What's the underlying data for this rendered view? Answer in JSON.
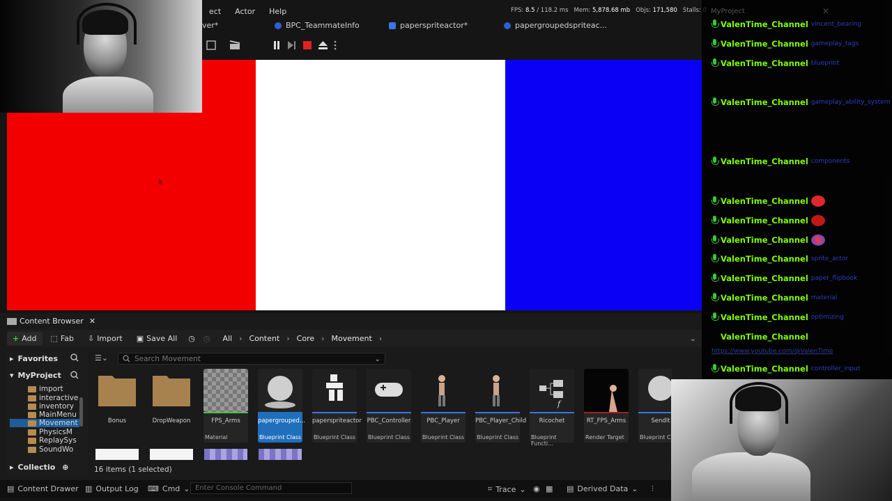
{
  "menu": {
    "items": [
      "ect",
      "Actor",
      "Help"
    ]
  },
  "stats": {
    "fps_label": "FPS:",
    "fps": "8.5",
    "ms": "/ 118.2 ms",
    "mem_label": "Mem:",
    "mem": "5,878.68 mb",
    "objs_label": "Objs:",
    "objs": "171,580",
    "stalls_label": "Stalls:",
    "stalls": "0"
  },
  "tabs": [
    {
      "label": "ver*"
    },
    {
      "label": "BPC_TeammateInfo"
    },
    {
      "label": "paperspriteactor*"
    },
    {
      "label": "papergroupedspriteac..."
    }
  ],
  "flag": {
    "colors": [
      "#f20000",
      "#ffffff",
      "#0a00f5"
    ]
  },
  "chat": {
    "title": "MyProject",
    "username": "ValenTime_Channel",
    "messages": [
      {
        "text": "vincent_bearing"
      },
      {
        "text": "gameplay_tags"
      },
      {
        "text": "blueprint"
      },
      {
        "text": "gameplay_ability_system"
      },
      {
        "text": "components"
      },
      {
        "text": ""
      },
      {
        "text": ""
      },
      {
        "text": ""
      },
      {
        "text": "sprite_actor"
      },
      {
        "text": "paper_flipbook"
      },
      {
        "text": "material"
      },
      {
        "text": "optimizing"
      },
      {
        "text": "https://www.youtube.com/@ValenTime"
      },
      {
        "text": "controller_input"
      }
    ],
    "emote_colors": [
      "#e0282c",
      "#c01818",
      "#ff3b2f"
    ]
  },
  "content_browser": {
    "tab_label": "Content Browser",
    "add_label": "Add",
    "fab_label": "Fab",
    "import_label": "Import",
    "save_all_label": "Save All",
    "breadcrumb": [
      "All",
      "Content",
      "Core",
      "Movement"
    ],
    "search_placeholder": "Search Movement",
    "favorites_label": "Favorites",
    "project_label": "MyProject",
    "collections_label": "Collectio",
    "folders": [
      "import",
      "interactive",
      "inventory",
      "MainMenu",
      "Movement",
      "PhysicsM",
      "ReplaySys",
      "SoundWo"
    ],
    "status": "16 items (1 selected)",
    "assets": [
      {
        "name": "Bonus",
        "type": ""
      },
      {
        "name": "DropWeapon",
        "type": ""
      },
      {
        "name": "FPS_Arms",
        "type": "Material"
      },
      {
        "name": "papergrouped...",
        "type": "Blueprint Class"
      },
      {
        "name": "paperspriteactor",
        "type": "Blueprint Class"
      },
      {
        "name": "PBC_Controller",
        "type": "Blueprint Class"
      },
      {
        "name": "PBC_Player",
        "type": "Blueprint Class"
      },
      {
        "name": "PBC_Player_Child",
        "type": "Blueprint Class"
      },
      {
        "name": "Ricochet",
        "type": "Blueprint Functi..."
      },
      {
        "name": "RT_FPS_Arms",
        "type": "Render Target"
      },
      {
        "name": "SendIt",
        "type": "Blueprint Clas"
      }
    ]
  },
  "bottom": {
    "drawer": "Content Drawer",
    "output": "Output Log",
    "cmd": "Cmd",
    "console_placeholder": "Enter Console Command",
    "trace": "Trace",
    "derived": "Derived Data"
  }
}
